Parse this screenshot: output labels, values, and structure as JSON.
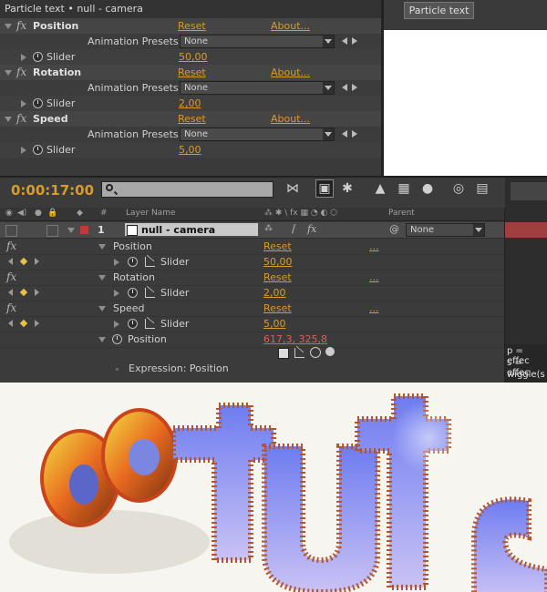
{
  "effect_controls": {
    "title": "Particle text • null - camera",
    "effects": [
      {
        "name": "Position",
        "reset": "Reset",
        "about": "About...",
        "presets_label": "Animation Presets:",
        "preset_value": "None",
        "slider_label": "Slider",
        "slider_value": "50,00"
      },
      {
        "name": "Rotation",
        "reset": "Reset",
        "about": "About...",
        "presets_label": "Animation Presets:",
        "preset_value": "None",
        "slider_label": "Slider",
        "slider_value": "2,00"
      },
      {
        "name": "Speed",
        "reset": "Reset",
        "about": "About...",
        "presets_label": "Animation Presets:",
        "preset_value": "None",
        "slider_label": "Slider",
        "slider_value": "5,00"
      }
    ]
  },
  "composition": {
    "tab_label": "Particle text"
  },
  "timeline": {
    "timecode": "0:00:17:00",
    "header": {
      "layer_name": "Layer Name",
      "parent": "Parent"
    },
    "layer": {
      "number": "1",
      "name": "null - camera",
      "parent_value": "None"
    },
    "effect_rows": [
      {
        "name": "Position",
        "reset": "Reset",
        "ellipsis": "...",
        "slider_label": "Slider",
        "slider_value": "50,00"
      },
      {
        "name": "Rotation",
        "reset": "Reset",
        "ellipsis": "...",
        "slider_label": "Slider",
        "slider_value": "2,00"
      },
      {
        "name": "Speed",
        "reset": "Reset",
        "ellipsis": "...",
        "slider_label": "Slider",
        "slider_value": "5,00"
      }
    ],
    "position_row": {
      "label": "Position",
      "value": "617,3, 325,8"
    },
    "expression_label": "Expression: Position",
    "expression_lines": [
      "p = effec",
      "s = effec",
      "wiggle(s"
    ]
  },
  "render": {
    "text": "aetuts"
  },
  "colors": {
    "accent_orange": "#d99b2a",
    "value_red": "#e25a5a",
    "layer_label_red": "#c13a3a"
  }
}
